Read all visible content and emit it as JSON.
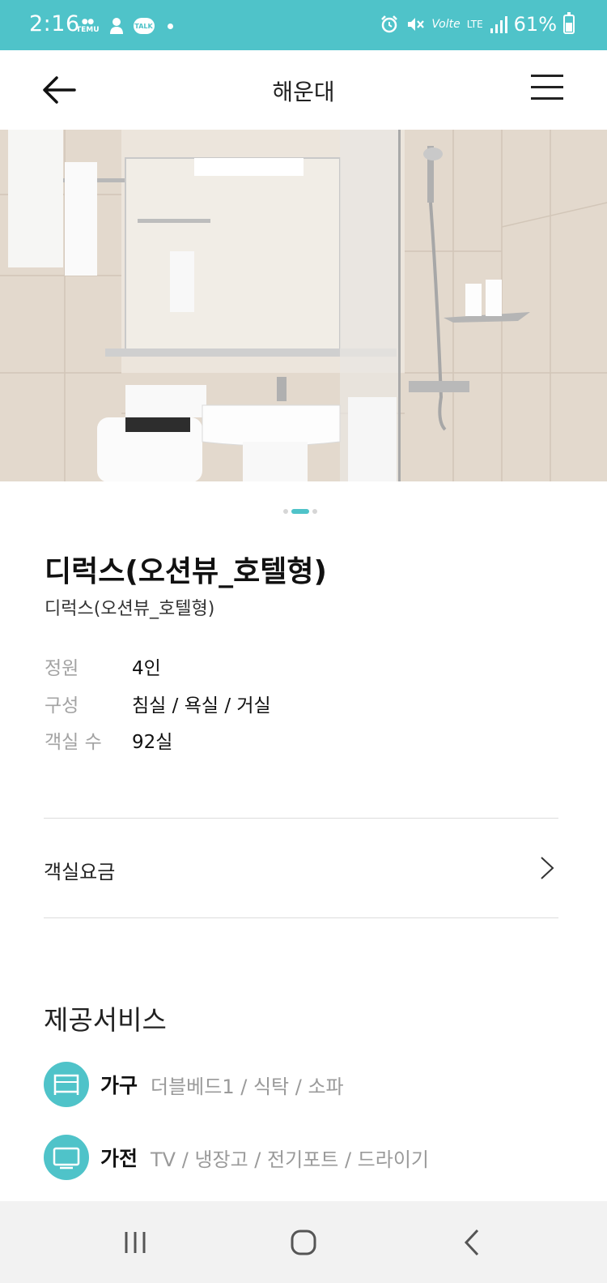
{
  "status_bar": {
    "time": "2:16",
    "left_icons": [
      "temu-icon",
      "chat-person-icon",
      "talk-icon",
      "dot-icon"
    ],
    "temu_text": "TEMU",
    "talk_text": "TALK",
    "volte_text": "Volte",
    "lte_text": "LTE",
    "battery_percent": "61%",
    "battery_level": 0.61,
    "background_color": "#4fc3c9"
  },
  "header": {
    "title": "해운대",
    "back_icon": "arrow-left-icon",
    "menu_icon": "hamburger-icon"
  },
  "gallery": {
    "image_description_icon": "bathroom-photo",
    "page_count": 3,
    "active_page": 2
  },
  "room": {
    "name": "디럭스(오션뷰_호텔형)",
    "subtitle": "디럭스(오션뷰_호텔형)",
    "details": [
      {
        "label": "정원",
        "value": "4인"
      },
      {
        "label": "구성",
        "value": "침실 / 욕실 / 거실"
      },
      {
        "label": "객실 수",
        "value": "92실"
      }
    ]
  },
  "rate": {
    "label": "객실요금",
    "icon": "chevron-right-icon"
  },
  "services": {
    "title": "제공서비스",
    "items": [
      {
        "name": "가구",
        "items": "더블베드1 / 식탁 / 소파",
        "icon": "bed-icon"
      },
      {
        "name": "가전",
        "items": "TV / 냉장고 / 전기포트 / 드라이기",
        "icon": "tv-icon"
      }
    ]
  },
  "colors": {
    "accent": "#4fc3c9",
    "muted_text": "#9a9a9a"
  },
  "nav_bar": {
    "buttons": [
      "recent-apps-icon",
      "home-icon",
      "back-chevron-icon"
    ]
  }
}
